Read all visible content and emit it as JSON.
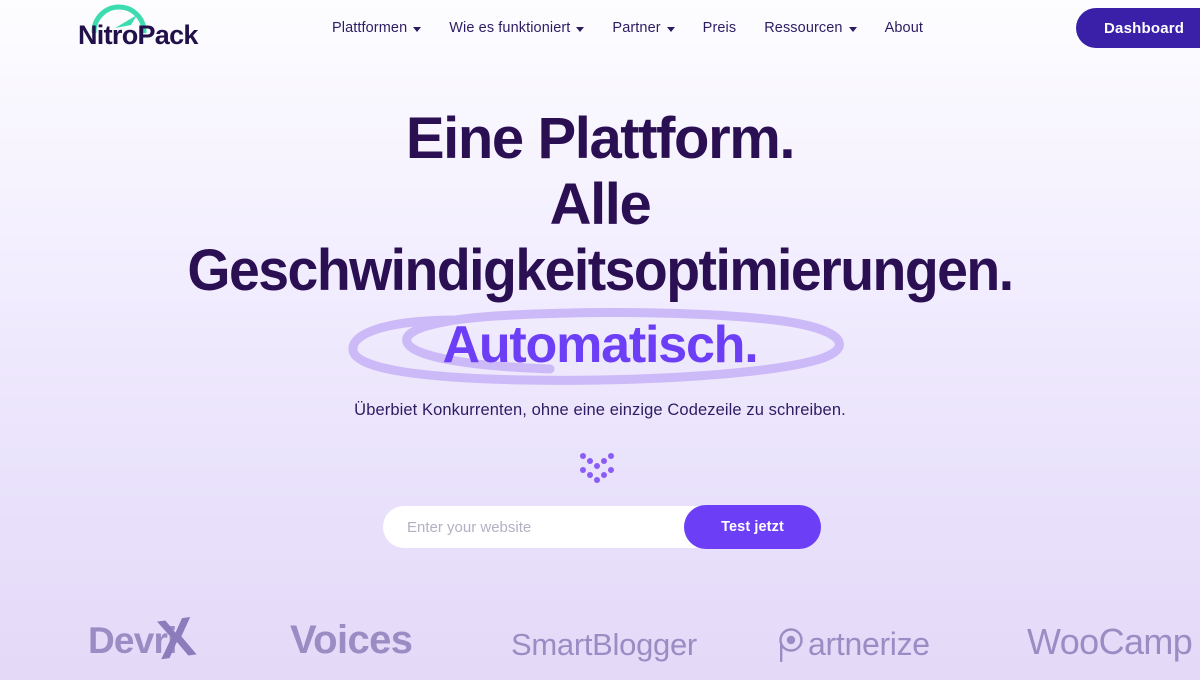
{
  "brand": {
    "name": "NitroPack",
    "logo_icon": "speedometer-gauge-icon",
    "logo_accent_color": "#3ddcb0",
    "logo_text_color": "#21104a"
  },
  "header": {
    "nav_items": [
      {
        "label": "Plattformen",
        "has_dropdown": true
      },
      {
        "label": "Wie es funktioniert",
        "has_dropdown": true
      },
      {
        "label": "Partner",
        "has_dropdown": true
      },
      {
        "label": "Preis",
        "has_dropdown": false
      },
      {
        "label": "Ressourcen",
        "has_dropdown": true
      },
      {
        "label": "About",
        "has_dropdown": false
      }
    ],
    "dashboard_button": "Dashboard",
    "dashboard_button_color": "#3a1fa8"
  },
  "hero": {
    "headline_line1": "Eine Plattform.",
    "headline_line2": "Alle",
    "headline_line3": "Geschwindigkeitsoptimierungen.",
    "headline_highlight": "Automatisch.",
    "headline_color": "#2b0f53",
    "highlight_color": "#6c3ef5",
    "circle_annotation_color": "#c6b0f7",
    "subtitle": "Überbiet Konkurrenten, ohne eine einzige Codezeile zu schreiben.",
    "scroll_hint_icon": "double-chevron-down-dots-icon",
    "scroll_hint_color": "#8b5cf6"
  },
  "cta": {
    "input_placeholder": "Enter your website",
    "input_value": "",
    "button_label": "Test jetzt",
    "button_color": "#6c3ef5"
  },
  "logos": {
    "strip_color": "#9b8cc4",
    "items": [
      {
        "name": "DevriX",
        "text": "Devri",
        "mark": "X"
      },
      {
        "name": "Voices",
        "text": "Voices"
      },
      {
        "name": "SmartBlogger",
        "text": "SmartBlogger"
      },
      {
        "name": "Partnerize",
        "text": "artnerize",
        "mark": "P"
      },
      {
        "name": "WooCamp",
        "text": "WooCamp"
      }
    ]
  }
}
